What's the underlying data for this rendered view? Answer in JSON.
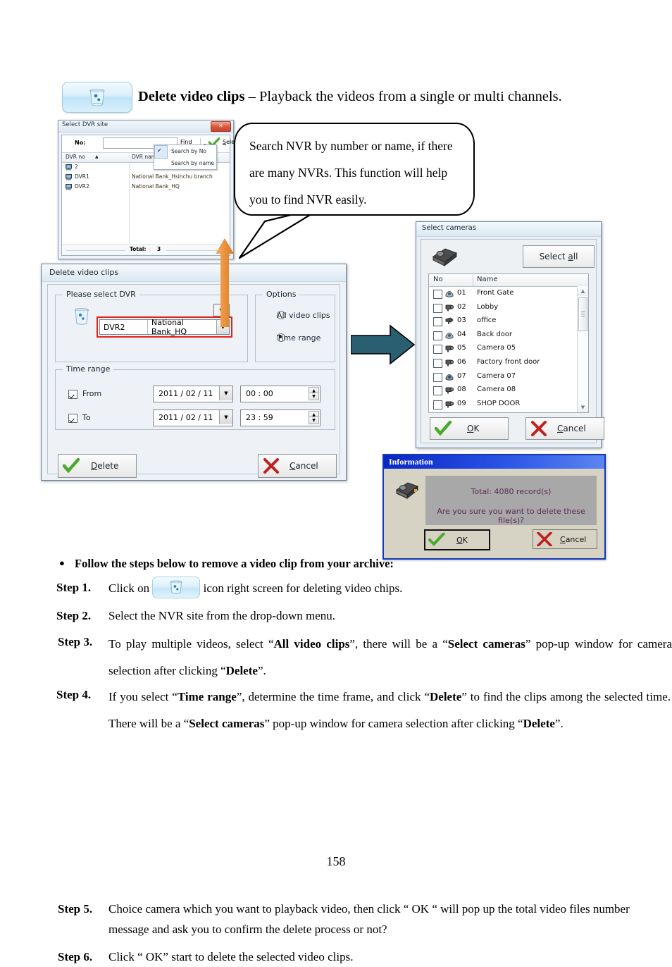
{
  "page": {
    "number": "158"
  },
  "header": {
    "icon": "trash-bin-icon",
    "title_bold": "Delete video clips",
    "title_rest": " – Playback the videos from a single or multi channels."
  },
  "speech_bubble": {
    "text": "Search NVR by number or name, if there are many NVRs. This function will help you to find NVR easily."
  },
  "dvr_site_dialog": {
    "title": "Select DVR site",
    "close_label": "✕",
    "no_label": "No:",
    "no_value": "",
    "find_label": "Find",
    "select_label": "Select",
    "select_underline": "S",
    "columns": {
      "no": "DVR no",
      "sort_arrow": "▲",
      "name": "DVR name"
    },
    "rows": [
      {
        "no": "2",
        "name": ""
      },
      {
        "no": "DVR1",
        "name": "National Bank_Hsinchu branch"
      },
      {
        "no": "DVR2",
        "name": "National Bank_HQ"
      }
    ],
    "total_label": "Total:",
    "total_value": "3",
    "search_menu": {
      "items": [
        {
          "label": "Search by No",
          "checked": true
        },
        {
          "label": "Search by name",
          "checked": false
        }
      ]
    }
  },
  "delete_dialog": {
    "title": "Delete video clips",
    "group_dvr_label": "Please select DVR",
    "group_options_label": "Options",
    "group_time_label": "Time range",
    "dvr_combo": {
      "no": "DVR2",
      "name": "National Bank_HQ",
      "caret": "▼",
      "highlight_color": "#e2231a"
    },
    "options": [
      {
        "label": "All video clips",
        "selected": false
      },
      {
        "label": "Time range",
        "selected": true
      }
    ],
    "time_rows": [
      {
        "label": "From",
        "checked": true,
        "date": "2011 / 02 / 11",
        "time": "00 : 00"
      },
      {
        "label": "To",
        "checked": true,
        "date": "2011 / 02 / 11",
        "time": "23 : 59"
      }
    ],
    "delete_label": "Delete",
    "delete_underline": "D",
    "cancel_label": "Cancel",
    "cancel_underline": "C"
  },
  "cameras_dialog": {
    "title": "Select cameras",
    "select_all_label": "Select all",
    "select_all_underline": "a",
    "columns": {
      "no": "No",
      "name": "Name"
    },
    "rows": [
      {
        "no": "01",
        "name": "Front Gate",
        "icon": "dome-camera-icon",
        "checked": false
      },
      {
        "no": "02",
        "name": "Lobby",
        "icon": "box-camera-icon",
        "checked": false
      },
      {
        "no": "03",
        "name": "office",
        "icon": "bullet-camera-icon",
        "checked": false
      },
      {
        "no": "04",
        "name": "Back door",
        "icon": "dome-camera-icon",
        "checked": false
      },
      {
        "no": "05",
        "name": "Camera 05",
        "icon": "box-camera-icon",
        "checked": false
      },
      {
        "no": "06",
        "name": "Factory front door",
        "icon": "box-camera-icon",
        "checked": false
      },
      {
        "no": "07",
        "name": "Camera 07",
        "icon": "dome-camera-icon",
        "checked": false
      },
      {
        "no": "08",
        "name": "Camera 08",
        "icon": "box-camera-icon",
        "checked": false
      },
      {
        "no": "09",
        "name": "SHOP DOOR",
        "icon": "box-camera-icon",
        "checked": false
      }
    ],
    "ok_label": "OK",
    "ok_underline": "O",
    "cancel_label": "Cancel",
    "cancel_underline": "C"
  },
  "information_dialog": {
    "title": "Information",
    "line1": "Total:   4080 record(s)",
    "line2": "Are you sure you want to delete these file(s)?",
    "ok_label": "OK",
    "ok_underline": "O",
    "cancel_label": "Cancel",
    "cancel_underline": "C",
    "title_color": "#1438b8",
    "text_color": "#5c2c53"
  },
  "instructions": {
    "bullet": "Follow the steps below to remove a video clip from your archive:",
    "step1": {
      "label": "Step 1.",
      "before": "Click on",
      "after": "icon right screen for deleting video chips."
    },
    "step2": {
      "label": "Step 2.",
      "text": "Select the NVR site from the drop-down menu."
    },
    "step3": {
      "label": "Step 3.",
      "t1": "To play multiple videos, select “",
      "b1": "All video clips",
      "t2": "”, there will be a “",
      "b2": "Select cameras",
      "t3": "” pop-up window for camera selection after clicking “",
      "b3": "Delete",
      "t4": "”."
    },
    "step4": {
      "label": "Step 4.",
      "t1": "If you select “",
      "b1": "Time range",
      "t2": "”, determine the time frame, and click “",
      "b2": "Delete",
      "t3": "” to find the clips among the selected time.    There will be a “",
      "b3": "Select cameras",
      "t4": "” pop-up window for camera selection after clicking “",
      "b4": "Delete",
      "t5": "”."
    },
    "step5": {
      "label": "Step 5.",
      "text": "Choice camera which you want to playback video, then click “ OK “ will pop up the total video files number message and ask you to confirm the delete process or not?"
    },
    "step6": {
      "label": "Step 6.",
      "text": "Click “ OK” start to delete the selected video clips."
    }
  },
  "arrows": {
    "orange": {
      "name": "orange-up-arrow",
      "color": "#e8922f"
    },
    "teal": {
      "name": "teal-right-arrow",
      "color": "#2a5f72"
    }
  }
}
